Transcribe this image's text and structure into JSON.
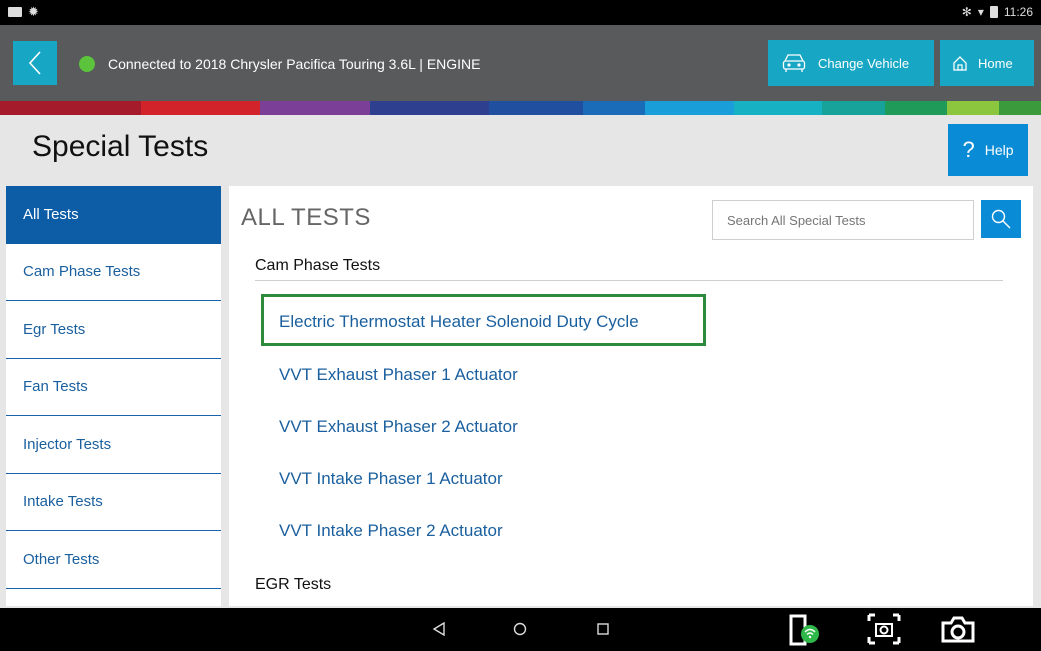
{
  "statusbar": {
    "time": "11:26",
    "bt_icon": "bluetooth-icon",
    "wifi_icon": "wifi-icon",
    "battery_icon": "battery-icon"
  },
  "header": {
    "connection_text": "Connected to 2018 Chrysler Pacifica Touring 3.6L | ENGINE",
    "status_color": "#5cc43c",
    "change_vehicle_label": "Change Vehicle",
    "home_label": "Home"
  },
  "stripe_colors": [
    "#a61b2b",
    "#d2232a",
    "#7b3f98",
    "#2e3f8f",
    "#1f4f9e",
    "#1a6bb8",
    "#1a9ed9",
    "#16b2c4",
    "#17a39a",
    "#1f9a59",
    "#8cc63f",
    "#3a9a3c"
  ],
  "page": {
    "title": "Special Tests",
    "help_label": "Help"
  },
  "sidebar": {
    "items": [
      {
        "label": "All Tests",
        "active": true
      },
      {
        "label": "Cam Phase Tests",
        "active": false
      },
      {
        "label": "Egr Tests",
        "active": false
      },
      {
        "label": "Fan Tests",
        "active": false
      },
      {
        "label": "Injector Tests",
        "active": false
      },
      {
        "label": "Intake Tests",
        "active": false
      },
      {
        "label": "Other Tests",
        "active": false
      }
    ]
  },
  "main": {
    "title": "ALL TESTS",
    "search_placeholder": "Search All Special Tests",
    "sections": [
      {
        "name": "Cam Phase Tests",
        "tests": [
          "Electric Thermostat Heater Solenoid Duty Cycle",
          "VVT Exhaust Phaser 1 Actuator",
          "VVT Exhaust Phaser 2 Actuator",
          "VVT Intake Phaser 1 Actuator",
          "VVT Intake Phaser 2 Actuator"
        ]
      },
      {
        "name": "EGR Tests",
        "tests": []
      }
    ]
  },
  "colors": {
    "accent": "#17a7c4",
    "help_blue": "#0a8bd6",
    "link_blue": "#1a5f9e",
    "active_blue": "#0d5ca6",
    "highlight_green": "#2e8b3e"
  }
}
